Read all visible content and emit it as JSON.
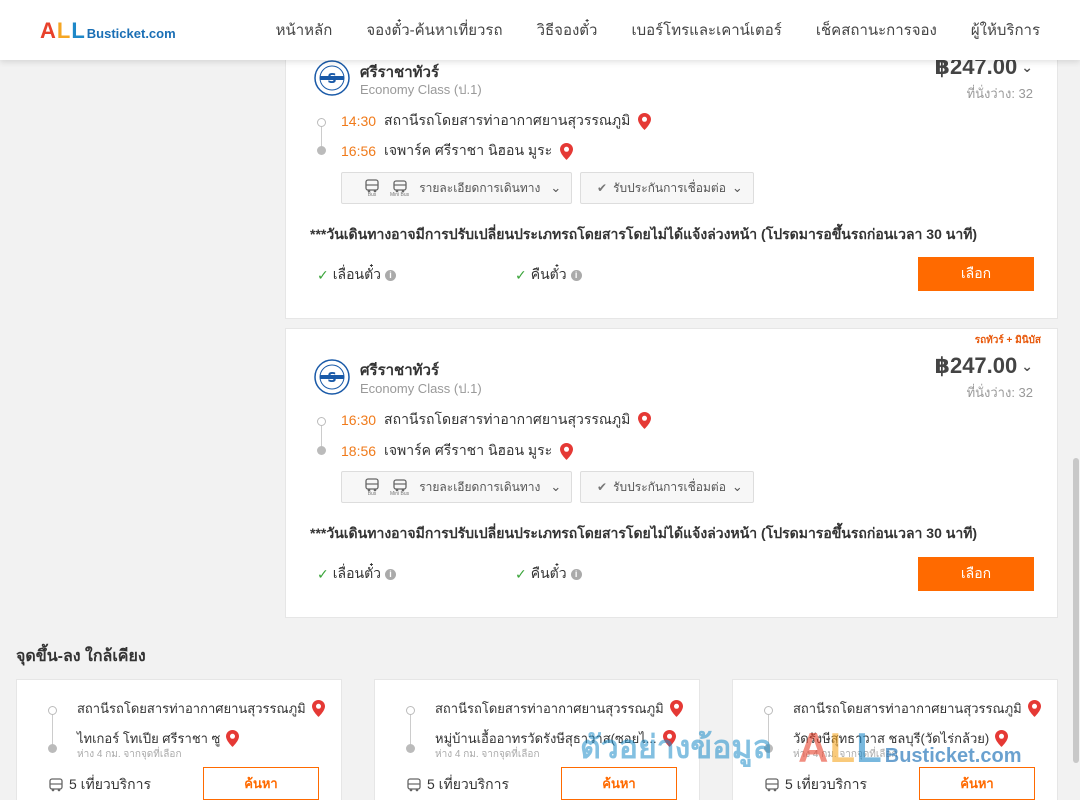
{
  "header": {
    "logo_all": "ALL",
    "logo_rest": "Busticket.com",
    "nav": [
      "หน้าหลัก",
      "จองตั๋ว-ค้นหาเที่ยวรถ",
      "วิธีจองตั๋ว",
      "เบอร์โทรและเคาน์เตอร์",
      "เช็คสถานะการจอง",
      "ผู้ให้บริการ"
    ]
  },
  "trips": [
    {
      "tag": "",
      "operator": "ศรีราชาทัวร์",
      "class": "Economy Class (ป.1)",
      "price": "฿247.00",
      "seats": "ที่นั่งว่าง: 32",
      "depart_time": "14:30",
      "depart_place": "สถานีรถโดยสารท่าอากาศยานสุวรรณภูมิ",
      "arrive_time": "16:56",
      "arrive_place": "เจพาร์ค ศรีราชา นิฮอน มูระ",
      "vehicle_bus": "Bus",
      "vehicle_minibus": "Mini Bus",
      "details_label": "รายละเอียดการเดินทาง",
      "guarantee_label": "รับประกันการเชื่อมต่อ",
      "notice": "***วันเดินทางอาจมีการปรับเปลี่ยนประเภทรถโดยสารโดยไม่ได้แจ้งล่วงหน้า (โปรดมารอขึ้นรถก่อนเวลา 30 นาที)",
      "feature_reschedule": "เลื่อนตั๋ว",
      "feature_refund": "คืนตั๋ว",
      "select_label": "เลือก"
    },
    {
      "tag": "รถทัวร์ + มินิบัส",
      "operator": "ศรีราชาทัวร์",
      "class": "Economy Class (ป.1)",
      "price": "฿247.00",
      "seats": "ที่นั่งว่าง: 32",
      "depart_time": "16:30",
      "depart_place": "สถานีรถโดยสารท่าอากาศยานสุวรรณภูมิ",
      "arrive_time": "18:56",
      "arrive_place": "เจพาร์ค ศรีราชา นิฮอน มูระ",
      "vehicle_bus": "Bus",
      "vehicle_minibus": "Mini Bus",
      "details_label": "รายละเอียดการเดินทาง",
      "guarantee_label": "รับประกันการเชื่อมต่อ",
      "notice": "***วันเดินทางอาจมีการปรับเปลี่ยนประเภทรถโดยสารโดยไม่ได้แจ้งล่วงหน้า (โปรดมารอขึ้นรถก่อนเวลา 30 นาที)",
      "feature_reschedule": "เลื่อนตั๋ว",
      "feature_refund": "คืนตั๋ว",
      "select_label": "เลือก"
    }
  ],
  "nearby": {
    "title": "จุดขึ้น-ลง ใกล้เคียง",
    "cards": [
      {
        "from": "สถานีรถโดยสารท่าอากาศยานสุวรรณภูมิ",
        "to": "ไทเกอร์ โทเปีย ศรีราชา ซู",
        "distance": "ห่าง 4 กม. จากจุดที่เลือก",
        "trips": "5 เที่ยวบริการ",
        "search_label": "ค้นหา"
      },
      {
        "from": "สถานีรถโดยสารท่าอากาศยานสุวรรณภูมิ",
        "to": "หมู่บ้านเอื้ออาทรวัดรังษีสุธาวาส(ซอยไ...",
        "distance": "ห่าง 4 กม. จากจุดที่เลือก",
        "trips": "5 เที่ยวบริการ",
        "search_label": "ค้นหา"
      },
      {
        "from": "สถานีรถโดยสารท่าอากาศยานสุวรรณภูมิ",
        "to": "วัดรังษีสุทธาวาส ชลบุรี(วัดไร่กล้วย)",
        "distance": "ห่าง 4 กม. จากจุดที่เลือก",
        "trips": "5 เที่ยวบริการ",
        "search_label": "ค้นหา"
      }
    ]
  },
  "watermark": {
    "text": "ตัวอย่างข้อมูล",
    "logo_all": "ALL",
    "logo_rest": "Busticket.com"
  },
  "colors": {
    "accent": "#ff6a00",
    "time": "#f07a1a",
    "pin": "#e53935",
    "check": "#3aa43a"
  }
}
